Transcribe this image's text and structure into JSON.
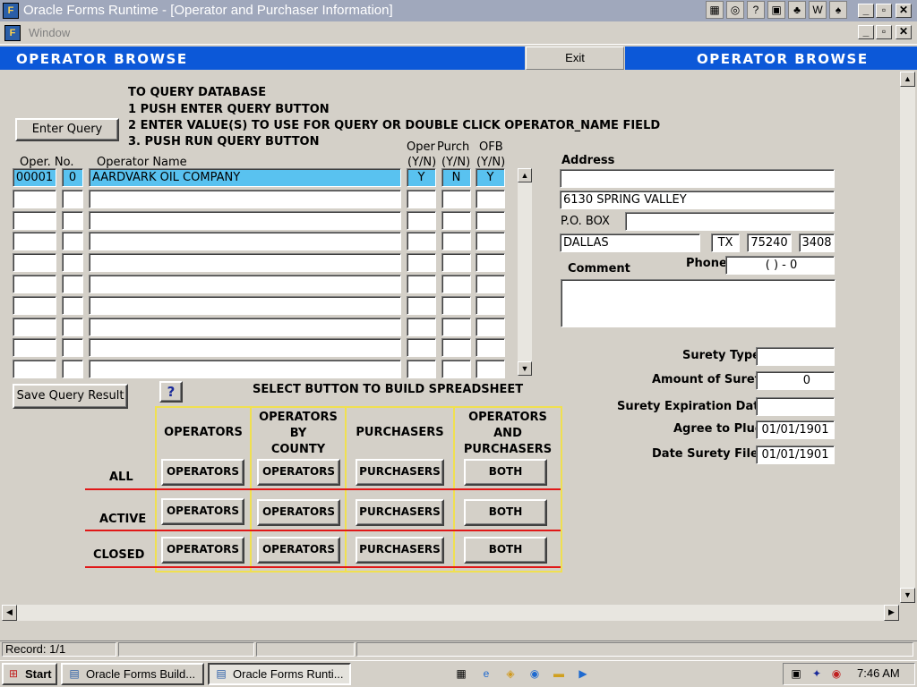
{
  "window": {
    "title": "Oracle Forms Runtime - [Operator and Purchaser Information]",
    "menu": "Window"
  },
  "header": {
    "left_title": "OPERATOR BROWSE",
    "right_title": "OPERATOR BROWSE",
    "exit_label": "Exit"
  },
  "instructions": {
    "line0": "TO QUERY DATABASE",
    "line1": "1 PUSH ENTER QUERY BUTTON",
    "line2": "2 ENTER VALUE(S) TO USE FOR QUERY OR DOUBLE CLICK OPERATOR_NAME FIELD",
    "line3": "3. PUSH RUN QUERY BUTTON"
  },
  "buttons": {
    "enter_query": "Enter Query",
    "save_query": "Save Query Result",
    "help": "?"
  },
  "table": {
    "col_oper_no": "Oper. No.",
    "col_operator_name": "Operator Name",
    "col_oper": "Oper",
    "col_purch": "Purch",
    "col_ofb": "OFB",
    "col_yn1": "(Y/N)",
    "col_yn2": "(Y/N)",
    "col_yn3": "(Y/N)",
    "rows": [
      {
        "no": "00001",
        "sub": "0",
        "name": "AARDVARK OIL COMPANY",
        "oper": "Y",
        "purch": "N",
        "ofb": "Y"
      },
      {
        "no": "",
        "sub": "",
        "name": "",
        "oper": "",
        "purch": "",
        "ofb": ""
      },
      {
        "no": "",
        "sub": "",
        "name": "",
        "oper": "",
        "purch": "",
        "ofb": ""
      },
      {
        "no": "",
        "sub": "",
        "name": "",
        "oper": "",
        "purch": "",
        "ofb": ""
      },
      {
        "no": "",
        "sub": "",
        "name": "",
        "oper": "",
        "purch": "",
        "ofb": ""
      },
      {
        "no": "",
        "sub": "",
        "name": "",
        "oper": "",
        "purch": "",
        "ofb": ""
      },
      {
        "no": "",
        "sub": "",
        "name": "",
        "oper": "",
        "purch": "",
        "ofb": ""
      },
      {
        "no": "",
        "sub": "",
        "name": "",
        "oper": "",
        "purch": "",
        "ofb": ""
      },
      {
        "no": "",
        "sub": "",
        "name": "",
        "oper": "",
        "purch": "",
        "ofb": ""
      },
      {
        "no": "",
        "sub": "",
        "name": "",
        "oper": "",
        "purch": "",
        "ofb": ""
      }
    ]
  },
  "address": {
    "label": "Address",
    "line1": "",
    "line2": "6130 SPRING VALLEY",
    "pobox_label": "P.O. BOX",
    "pobox": "",
    "city": "DALLAS",
    "state": "TX",
    "zip": "75240",
    "zip4": "3408",
    "comment_label": "Comment",
    "comment": "",
    "phone_label": "Phone",
    "phone": "(    )   -  0"
  },
  "surety": {
    "type_label": "Surety Type",
    "type": "",
    "amount_label": "Amount of Surety",
    "amount": "0",
    "exp_label": "Surety Expiration Date",
    "exp": "",
    "plug_label": "Agree to Plug",
    "plug": "01/01/1901",
    "filed_label": "Date Surety Filed",
    "filed": "01/01/1901"
  },
  "spreadsheet": {
    "title": "SELECT BUTTON TO BUILD SPREADSHEET",
    "h1": "OPERATORS",
    "h2a": "OPERATORS",
    "h2b": "BY",
    "h2c": "COUNTY",
    "h3": "PURCHASERS",
    "h4a": "OPERATORS",
    "h4b": "AND",
    "h4c": "PURCHASERS",
    "row_all": "ALL",
    "row_active": "ACTIVE",
    "row_closed": "CLOSED",
    "btn_operators": "OPERATORS",
    "btn_purchasers": "PURCHASERS",
    "btn_both": "BOTH"
  },
  "status": {
    "record": "Record: 1/1"
  },
  "taskbar": {
    "start": "Start",
    "task1": "Oracle Forms Build...",
    "task2": "Oracle Forms Runti...",
    "clock": "7:46 AM"
  },
  "colors": {
    "header_blue": "#0c58d8",
    "selected_row": "#59c2f0",
    "grid_yellow": "#f0e050",
    "divider_red": "#e01818"
  }
}
